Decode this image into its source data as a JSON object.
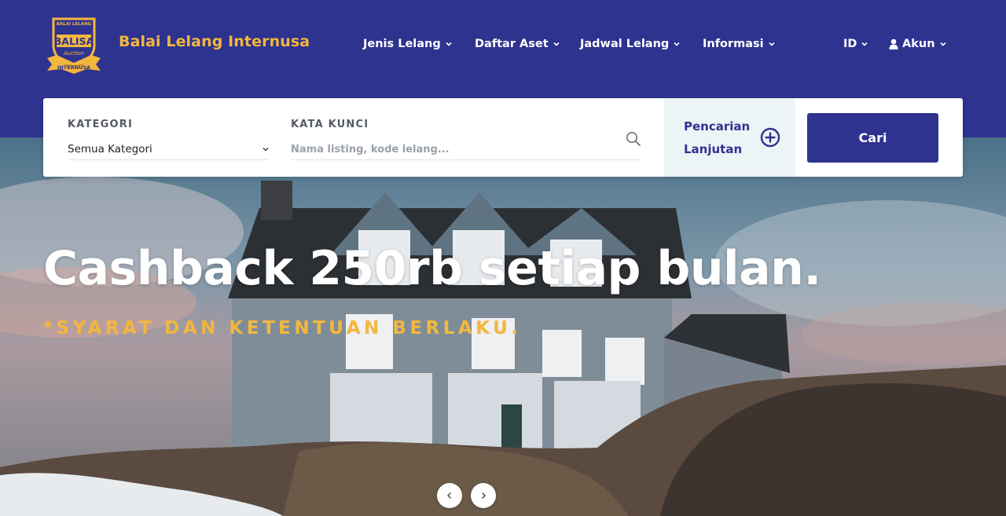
{
  "header": {
    "logo": {
      "top_text": "BALAI LELANG",
      "main_text": "BALISA",
      "script_text": "Auction",
      "ribbon_text": "INTERNUSA"
    },
    "brand_name": "Balai Lelang Internusa",
    "nav": [
      {
        "label": "Jenis Lelang",
        "icon": "chevron-down-icon"
      },
      {
        "label": "Daftar Aset",
        "icon": "chevron-down-icon"
      },
      {
        "label": "Jadwal Lelang",
        "icon": "chevron-down-icon"
      },
      {
        "label": "Informasi",
        "icon": "chevron-down-icon"
      }
    ],
    "language": {
      "label": "ID",
      "icon": "chevron-down-icon"
    },
    "account": {
      "label": "Akun",
      "icon": "user-icon"
    }
  },
  "search": {
    "category_label": "KATEGORI",
    "category_value": "Semua Kategori",
    "keyword_label": "KATA KUNCI",
    "keyword_placeholder": "Nama listing, kode lelang...",
    "keyword_value": "",
    "advanced_label": "Pencarian Lanjutan",
    "submit_label": "Cari"
  },
  "hero": {
    "title": "Cashback 250rb setiap bulan.",
    "subtitle": "*SYARAT DAN KETENTUAN BERLAKU."
  },
  "colors": {
    "primary": "#2e3390",
    "accent": "#f3b73e",
    "advanced_bg": "#edf4f6"
  }
}
